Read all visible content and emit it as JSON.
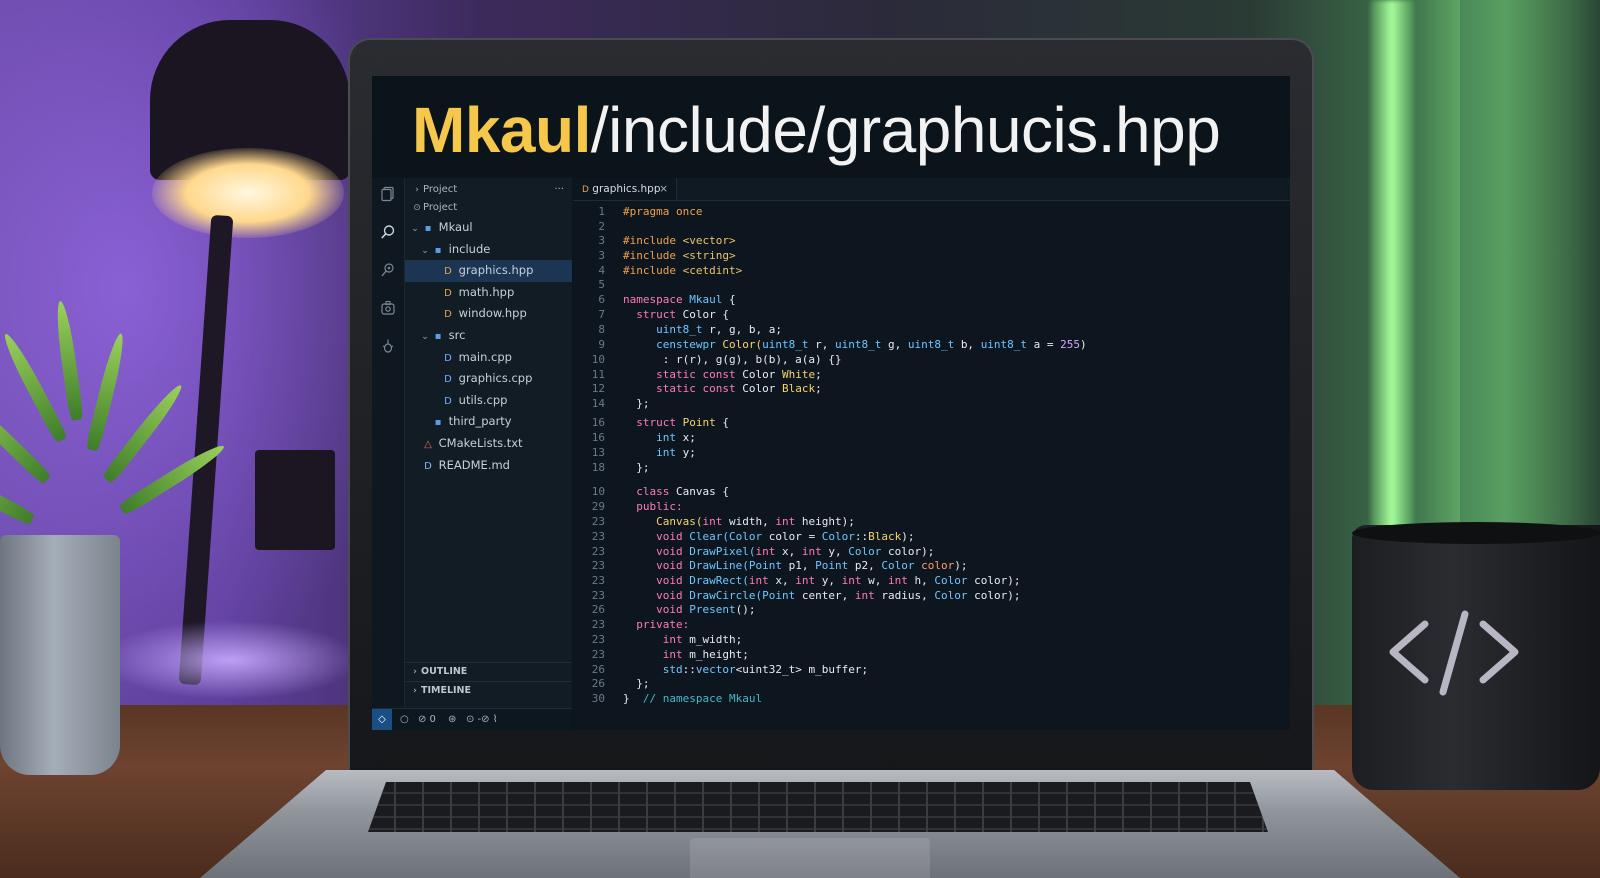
{
  "window_title": {
    "prefix": "Mkaul",
    "rest": "/include/graphucis.hpp"
  },
  "activity_bar": {
    "icons": [
      "files-icon",
      "search-icon",
      "source-control-icon",
      "extensions-icon",
      "debug-icon"
    ]
  },
  "explorer": {
    "header": "Project",
    "menu": "···",
    "workspace": "Project",
    "items": [
      {
        "label": "Mkaul",
        "kind": "folder",
        "depth": 0,
        "chevron": "⌄"
      },
      {
        "label": "include",
        "kind": "folder",
        "depth": 1,
        "chevron": "⌄"
      },
      {
        "label": "graphics.hpp",
        "kind": "hpp",
        "depth": 2,
        "selected": true
      },
      {
        "label": "math.hpp",
        "kind": "hpp",
        "depth": 2
      },
      {
        "label": "window.hpp",
        "kind": "hpp",
        "depth": 2
      },
      {
        "label": "src",
        "kind": "folder",
        "depth": 1,
        "chevron": "⌄"
      },
      {
        "label": "main.cpp",
        "kind": "cpp",
        "depth": 2
      },
      {
        "label": "graphics.cpp",
        "kind": "cpp",
        "depth": 2
      },
      {
        "label": "utils.cpp",
        "kind": "cpp",
        "depth": 2
      },
      {
        "label": "third_party",
        "kind": "folder",
        "depth": 1
      },
      {
        "label": "CMakeLists.txt",
        "kind": "cmake",
        "depth": 0
      },
      {
        "label": "README.md",
        "kind": "md",
        "depth": 0
      }
    ],
    "outline": "OUTLINE",
    "timeline": "TIMELINE"
  },
  "editor": {
    "tab_label": "graphics.hpp",
    "tab_close": "×",
    "colors": {
      "preproc": "#f0a04b",
      "string": "#e8c46a",
      "keyword": "#ff7ab8",
      "type": "#6ec6ff",
      "func": "#f7d36b",
      "param": "#ff9d6c",
      "comment": "#46b8c9",
      "number": "#d7a6ff",
      "plain": "#e6ecf1"
    },
    "lines": [
      {
        "n": "1",
        "tokens": [
          [
            "#pragma once",
            "preproc"
          ]
        ]
      },
      {
        "n": "2",
        "tokens": []
      },
      {
        "n": "3",
        "tokens": [
          [
            "#include ",
            "preproc"
          ],
          [
            "<vector>",
            "string"
          ]
        ]
      },
      {
        "n": "3",
        "tokens": [
          [
            "#include ",
            "preproc"
          ],
          [
            "<string>",
            "string"
          ]
        ]
      },
      {
        "n": "4",
        "tokens": [
          [
            "#include ",
            "preproc"
          ],
          [
            "<cetdint>",
            "string"
          ]
        ]
      },
      {
        "n": "5",
        "tokens": []
      },
      {
        "n": "6",
        "tokens": [
          [
            "namespace ",
            "keyword"
          ],
          [
            "Mkaul ",
            "type"
          ],
          [
            "{",
            "plain"
          ]
        ]
      },
      {
        "n": "7",
        "tokens": [
          [
            "  ",
            "plain"
          ],
          [
            "struct ",
            "keyword"
          ],
          [
            "Color ",
            "plain"
          ],
          [
            "{",
            "plain"
          ]
        ]
      },
      {
        "n": "8",
        "tokens": [
          [
            "     ",
            "plain"
          ],
          [
            "uint8_t ",
            "type"
          ],
          [
            "r, g, b, a;",
            "plain"
          ]
        ]
      },
      {
        "n": "9",
        "tokens": [
          [
            "     ",
            "plain"
          ],
          [
            "censtewpr ",
            "type"
          ],
          [
            "Color(",
            "func"
          ],
          [
            "uint8_t ",
            "type"
          ],
          [
            "r, ",
            "plain"
          ],
          [
            "uint8_t ",
            "type"
          ],
          [
            "g, ",
            "plain"
          ],
          [
            "uint8_t ",
            "type"
          ],
          [
            "b, ",
            "plain"
          ],
          [
            "uint8_t ",
            "type"
          ],
          [
            "a = ",
            "plain"
          ],
          [
            "255",
            "number"
          ],
          [
            ")",
            "plain"
          ]
        ]
      },
      {
        "n": "10",
        "tokens": [
          [
            "      : r(r), g(g), b(b), a(a) {}",
            "plain"
          ]
        ]
      },
      {
        "n": "11",
        "tokens": [
          [
            "     ",
            "plain"
          ],
          [
            "static const ",
            "keyword"
          ],
          [
            "Color ",
            "plain"
          ],
          [
            "White",
            "func"
          ],
          [
            ";",
            "plain"
          ]
        ]
      },
      {
        "n": "12",
        "tokens": [
          [
            "     ",
            "plain"
          ],
          [
            "static const ",
            "keyword"
          ],
          [
            "Color ",
            "plain"
          ],
          [
            "Black",
            "func"
          ],
          [
            ";",
            "plain"
          ]
        ]
      },
      {
        "n": "14",
        "tokens": [
          [
            "  };",
            "plain"
          ]
        ]
      },
      {
        "n": "16",
        "tokens": [
          [
            "  ",
            "plain"
          ],
          [
            "struct ",
            "keyword"
          ],
          [
            "Point ",
            "func"
          ],
          [
            "{",
            "plain"
          ]
        ]
      },
      {
        "n": "16",
        "tokens": [
          [
            "     ",
            "plain"
          ],
          [
            "int ",
            "type"
          ],
          [
            "x;",
            "plain"
          ]
        ]
      },
      {
        "n": "13",
        "tokens": [
          [
            "     ",
            "plain"
          ],
          [
            "int ",
            "type"
          ],
          [
            "y;",
            "plain"
          ]
        ]
      },
      {
        "n": "18",
        "tokens": [
          [
            "  };",
            "plain"
          ]
        ]
      },
      {
        "n": "10",
        "tokens": [
          [
            "  ",
            "plain"
          ],
          [
            "class ",
            "keyword"
          ],
          [
            "Canvas ",
            "plain"
          ],
          [
            "{",
            "plain"
          ]
        ]
      },
      {
        "n": "29",
        "tokens": [
          [
            "  ",
            "plain"
          ],
          [
            "public:",
            "keyword"
          ]
        ]
      },
      {
        "n": "23",
        "tokens": [
          [
            "     ",
            "plain"
          ],
          [
            "Canvas(",
            "func"
          ],
          [
            "int ",
            "keyword"
          ],
          [
            "width, ",
            "plain"
          ],
          [
            "int ",
            "keyword"
          ],
          [
            "height);",
            "plain"
          ]
        ]
      },
      {
        "n": "23",
        "tokens": [
          [
            "     ",
            "plain"
          ],
          [
            "void ",
            "keyword"
          ],
          [
            "Clear(",
            "type"
          ],
          [
            "Color ",
            "type"
          ],
          [
            "color = ",
            "plain"
          ],
          [
            "Color",
            "type"
          ],
          [
            "::",
            "plain"
          ],
          [
            "Black",
            "func"
          ],
          [
            ");",
            "plain"
          ]
        ]
      },
      {
        "n": "23",
        "tokens": [
          [
            "     ",
            "plain"
          ],
          [
            "void ",
            "keyword"
          ],
          [
            "DrawPixel(",
            "type"
          ],
          [
            "int ",
            "keyword"
          ],
          [
            "x, ",
            "plain"
          ],
          [
            "int ",
            "keyword"
          ],
          [
            "y, ",
            "plain"
          ],
          [
            "Color ",
            "type"
          ],
          [
            "color);",
            "plain"
          ]
        ]
      },
      {
        "n": "23",
        "tokens": [
          [
            "     ",
            "plain"
          ],
          [
            "void ",
            "keyword"
          ],
          [
            "DrawLine(",
            "type"
          ],
          [
            "Point ",
            "type"
          ],
          [
            "p1, ",
            "plain"
          ],
          [
            "Point ",
            "type"
          ],
          [
            "p2, ",
            "plain"
          ],
          [
            "Color ",
            "type"
          ],
          [
            "color",
            "param"
          ],
          [
            ");",
            "plain"
          ]
        ]
      },
      {
        "n": "23",
        "tokens": [
          [
            "     ",
            "plain"
          ],
          [
            "void ",
            "keyword"
          ],
          [
            "DrawRect(",
            "type"
          ],
          [
            "int ",
            "keyword"
          ],
          [
            "x, ",
            "plain"
          ],
          [
            "int ",
            "keyword"
          ],
          [
            "y, ",
            "plain"
          ],
          [
            "int ",
            "keyword"
          ],
          [
            "w, ",
            "plain"
          ],
          [
            "int ",
            "keyword"
          ],
          [
            "h, ",
            "plain"
          ],
          [
            "Color ",
            "type"
          ],
          [
            "color);",
            "plain"
          ]
        ]
      },
      {
        "n": "23",
        "tokens": [
          [
            "     ",
            "plain"
          ],
          [
            "void ",
            "keyword"
          ],
          [
            "DrawCircle(",
            "type"
          ],
          [
            "Point ",
            "type"
          ],
          [
            "center, ",
            "plain"
          ],
          [
            "int ",
            "keyword"
          ],
          [
            "radius, ",
            "plain"
          ],
          [
            "Color ",
            "type"
          ],
          [
            "color);",
            "plain"
          ]
        ]
      },
      {
        "n": "26",
        "tokens": [
          [
            "     ",
            "plain"
          ],
          [
            "void ",
            "keyword"
          ],
          [
            "Present",
            "type"
          ],
          [
            "();",
            "plain"
          ]
        ]
      },
      {
        "n": "23",
        "tokens": [
          [
            "  ",
            "plain"
          ],
          [
            "private:",
            "keyword"
          ]
        ]
      },
      {
        "n": "23",
        "tokens": [
          [
            "      ",
            "plain"
          ],
          [
            "int ",
            "keyword"
          ],
          [
            "m_width;",
            "plain"
          ]
        ]
      },
      {
        "n": "23",
        "tokens": [
          [
            "      ",
            "plain"
          ],
          [
            "int ",
            "keyword"
          ],
          [
            "m_height;",
            "plain"
          ]
        ]
      },
      {
        "n": "26",
        "tokens": [
          [
            "      ",
            "plain"
          ],
          [
            "std",
            "type"
          ],
          [
            "::",
            "plain"
          ],
          [
            "vector",
            "type"
          ],
          [
            "<uint32_t> ",
            "plain"
          ],
          [
            "m_buffer;",
            "plain"
          ]
        ]
      },
      {
        "n": "26",
        "tokens": [
          [
            "  };",
            "plain"
          ]
        ]
      },
      {
        "n": "30",
        "tokens": [
          [
            "}  ",
            "plain"
          ],
          [
            "// namespace Mkaul",
            "comment"
          ]
        ]
      }
    ]
  },
  "statusbar": {
    "items": [
      "◇",
      "○",
      "⊘ 0",
      "⊛",
      "⊙ -⊘ ⌇"
    ]
  },
  "mug": {
    "glyph": "</>"
  }
}
